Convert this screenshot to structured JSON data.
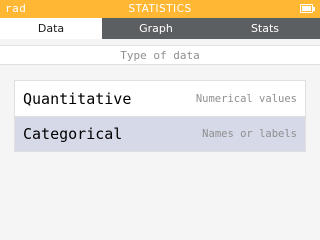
{
  "status_bar": {
    "angle_mode": "rad",
    "app_title": "STATISTICS",
    "battery_icon": "battery-icon",
    "colors": {
      "background": "#ffb734",
      "text": "#ffffff"
    }
  },
  "tabs": [
    {
      "label": "Data",
      "selected": true
    },
    {
      "label": "Graph",
      "selected": false
    },
    {
      "label": "Stats",
      "selected": false
    }
  ],
  "main": {
    "section_title": "Type of data",
    "options": [
      {
        "label": "Quantitative",
        "sublabel": "Numerical values",
        "selected": false
      },
      {
        "label": "Categorical",
        "sublabel": "Names or labels",
        "selected": true
      }
    ]
  },
  "colors": {
    "tab_bar": "#5c5f61",
    "selected_row": "#d6d9e8",
    "hint_text": "#8f8f8f"
  }
}
